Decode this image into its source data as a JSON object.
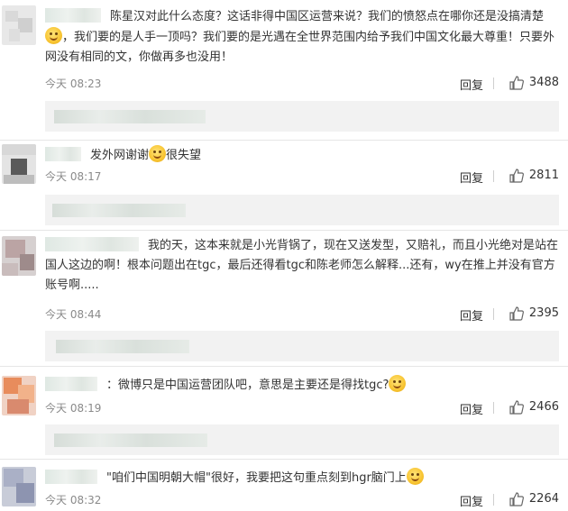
{
  "comments": [
    {
      "text_a": "陈星汉对此什么态度？这话非得中国区运营来说？我们的愤怒点在哪你还是没搞清楚",
      "text_b": "，我们要的是人手一顶吗？我们要的是光遇在全世界范围内给予我们中国文化最大尊重！只要外网没有相同的文，你做再多也没用！",
      "time": "今天 08:23",
      "reply": "回复",
      "likes": "3488",
      "emoji_icon": "smile-emoji-icon"
    },
    {
      "text_a": "发外网谢谢",
      "text_b": "很失望",
      "time": "今天 08:17",
      "reply": "回复",
      "likes": "2811",
      "emoji_icon": "sweat-smile-emoji-icon"
    },
    {
      "text_a": "我的天，这本来就是小光背锅了，现在又送发型，又赔礼，而且小光绝对是站在国人这边的啊！根本问题出在tgc，最后还得看tgc和陈老师怎么解释...还有，wy在推上并没有官方账号啊.....",
      "time": "今天 08:44",
      "reply": "回复",
      "likes": "2395"
    },
    {
      "text_a": "：微博只是中国运营团队吧，意思是主要还是得找tgc?",
      "time": "今天 08:19",
      "reply": "回复",
      "likes": "2466",
      "emoji_icon": "confused-emoji-icon"
    },
    {
      "text_a": "\"咱们中国明朝大帽\"很好，我要把这句重点刻到hgr脑门上",
      "time": "今天 08:32",
      "reply": "回复",
      "likes": "2264",
      "emoji_icon": "smile-emoji-icon"
    }
  ],
  "colors": {
    "background": "#ffffff",
    "subreply_bg": "#f2f2f2",
    "meta_gray": "#8a8a8a",
    "emoji_yellow": "#f8c431"
  }
}
